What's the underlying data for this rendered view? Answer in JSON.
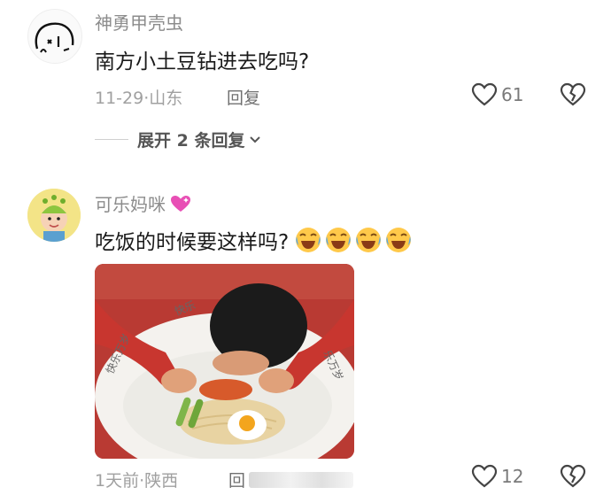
{
  "comment1": {
    "username": "神勇甲壳虫",
    "text": "南方小土豆钻进去吃吗?",
    "time": "11-29",
    "separator": "·",
    "location": "山东",
    "reply_label": "回复",
    "like_count": "61",
    "expand_label": "展开 2 条回复"
  },
  "comment2": {
    "username": "可乐妈咪",
    "text": "吃饭的时候要这样吗?",
    "emojis": [
      "crying-laugh",
      "crying-laugh",
      "crying-laugh",
      "crying-laugh"
    ],
    "photo_bowl_text_left": "快乐万岁",
    "photo_bowl_text_top": "快乐",
    "photo_bowl_text_right": "乐万岁",
    "time": "1天前",
    "separator": "·",
    "location": "陕西",
    "reply_label": "回",
    "like_count": "12"
  },
  "colors": {
    "username": "#8c8c8c",
    "meta": "#a0a0a0",
    "emoji_yellow": "#ffc94a",
    "heart_stroke": "#444444",
    "sweater_red": "#c8362f"
  }
}
